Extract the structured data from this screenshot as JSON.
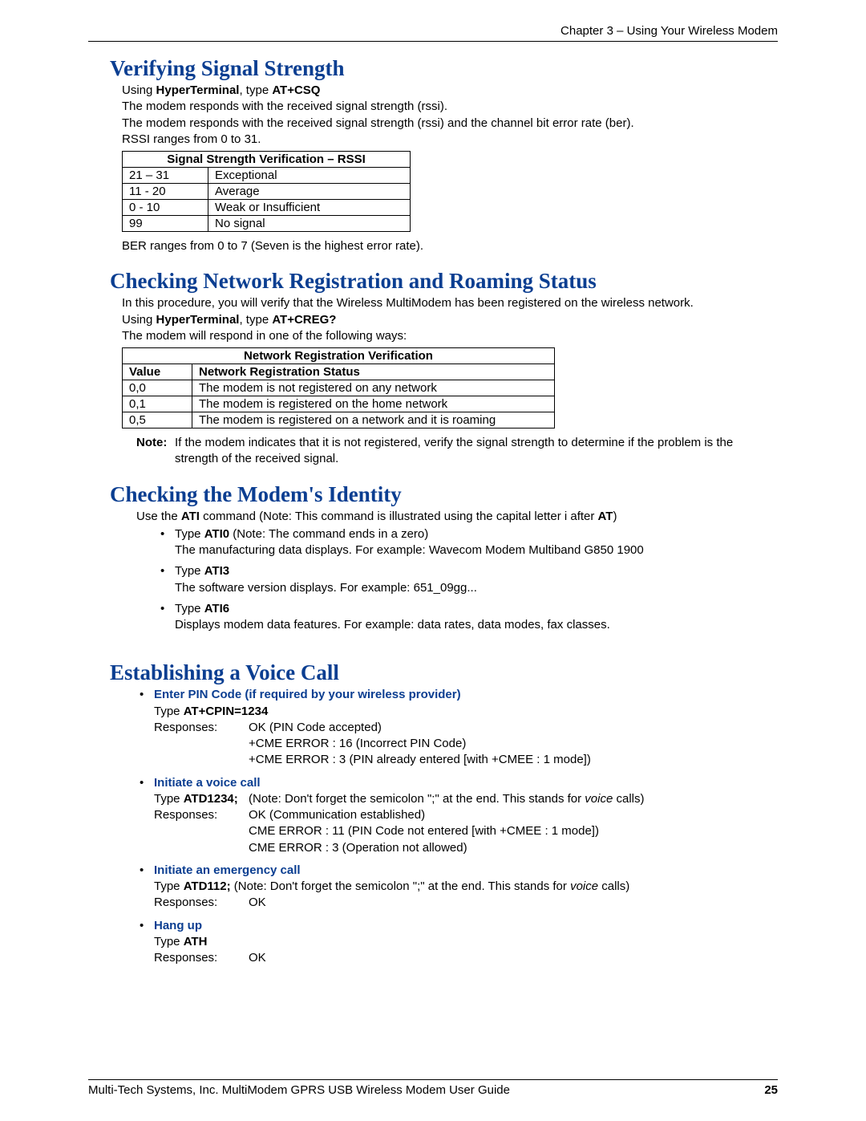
{
  "header": {
    "chapter": "Chapter 3 – Using Your Wireless Modem"
  },
  "s1": {
    "title": "Verifying Signal Strength",
    "p1_a": "Using ",
    "p1_b": "HyperTerminal",
    "p1_c": ", type ",
    "p1_d": "AT+CSQ",
    "p2": "The modem responds with the received signal strength (rssi).",
    "p3": "The modem responds with the received signal strength (rssi) and the channel bit error rate (ber).",
    "p4": "RSSI ranges from 0 to 31.",
    "table_title": "Signal Strength Verification – RSSI",
    "rows": [
      {
        "r": "21 – 31",
        "d": "Exceptional"
      },
      {
        "r": "11 - 20",
        "d": "Average"
      },
      {
        "r": "0 - 10",
        "d": "Weak or Insufficient"
      },
      {
        "r": "99",
        "d": "No signal"
      }
    ],
    "p5": "BER ranges from 0 to 7 (Seven is the highest error rate)."
  },
  "s2": {
    "title": "Checking Network Registration and Roaming Status",
    "p1": "In this procedure, you will verify that the Wireless MultiModem has been registered on the wireless network.",
    "p2_a": "Using ",
    "p2_b": "HyperTerminal",
    "p2_c": ", type ",
    "p2_d": "AT+CREG?",
    "p3": "The modem will respond in one of the following ways:",
    "table_title": "Network Registration Verification",
    "col1": "Value",
    "col2": "Network Registration Status",
    "rows": [
      {
        "v": "0,0",
        "s": "The modem is not registered on any network"
      },
      {
        "v": "0,1",
        "s": "The modem is registered on the home network"
      },
      {
        "v": "0,5",
        "s": "The modem is registered on a network and it is roaming"
      }
    ],
    "note_label": "Note:",
    "note": "If the modem indicates that it is not registered, verify the signal strength to determine if the problem is the strength of the received signal."
  },
  "s3": {
    "title": "Checking the Modem's Identity",
    "intro_a": "Use the ",
    "intro_b": "ATI",
    "intro_c": " command (Note: This command is illustrated using the capital letter i after ",
    "intro_d": "AT",
    "intro_e": ")",
    "items": [
      {
        "label": "ATI0",
        "note": " (Note: The command ends in a zero)",
        "desc": "The manufacturing data displays. For example: Wavecom Modem Multiband G850 1900"
      },
      {
        "label": "ATI3",
        "note": "",
        "desc": "The software version displays. For example: 651_09gg..."
      },
      {
        "label": "ATI6",
        "note": "",
        "desc": "Displays modem data features. For example: data rates, data modes, fax classes."
      }
    ],
    "type_word": "Type "
  },
  "s4": {
    "title": "Establishing a Voice Call",
    "pin": {
      "heading": "Enter PIN Code (if required by your wireless provider)",
      "type_a": "Type ",
      "type_b": "AT+CPIN=1234",
      "resp_label": "Responses:",
      "r1": "OK  (PIN Code accepted)",
      "r2": "+CME ERROR : 16 (Incorrect PIN Code)",
      "r3": "+CME ERROR : 3 (PIN already entered [with +CMEE : 1 mode])"
    },
    "voice": {
      "heading": "Initiate a voice call",
      "type_a": "Type ",
      "type_b": "ATD1234;",
      "type_note_a": "(Note: Don't forget the semicolon \";\" at the end. This stands for ",
      "type_note_b": "voice",
      "type_note_c": " calls)",
      "resp_label": "Responses:",
      "r1": "OK (Communication established)",
      "r2": "CME ERROR : 11  (PIN Code not entered [with +CMEE : 1 mode])",
      "r3": "CME ERROR : 3    (Operation not allowed)"
    },
    "emerg": {
      "heading": "Initiate an emergency call",
      "type_a": "Type ",
      "type_b": "ATD112;",
      "type_note_a": " (Note: Don't forget the semicolon \";\" at the end. This stands for ",
      "type_note_b": "voice",
      "type_note_c": " calls)",
      "resp_label": "Responses:",
      "r1": "OK"
    },
    "hang": {
      "heading": "Hang up",
      "type_a": "Type ",
      "type_b": "ATH",
      "resp_label": "Responses:",
      "r1": "OK"
    }
  },
  "footer": {
    "left": "Multi-Tech Systems, Inc. MultiModem GPRS USB Wireless Modem User Guide",
    "right": "25"
  }
}
